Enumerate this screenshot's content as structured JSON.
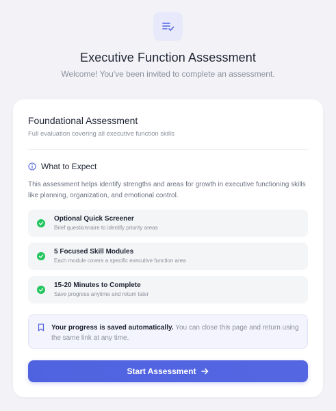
{
  "header": {
    "title": "Executive Function Assessment",
    "subtitle": "Welcome! You've been invited to complete an assessment.",
    "logo_icon": "list-check-icon"
  },
  "card": {
    "title": "Foundational Assessment",
    "description": "Full evaluation covering all executive function skills",
    "expect_heading": "What to Expect",
    "intro": "This assessment helps identify strengths and areas for growth in executive functioning skills like planning, organization, and emotional control.",
    "features": [
      {
        "title": "Optional Quick Screener",
        "description": "Brief questionnaire to identify priority areas"
      },
      {
        "title": "5 Focused Skill Modules",
        "description": "Each module covers a specific executive function area"
      },
      {
        "title": "15-20 Minutes to Complete",
        "description": "Save progress anytime and return later"
      }
    ],
    "notice": {
      "bold": "Your progress is saved automatically.",
      "text": " You can close this page and return using the same link at any time."
    },
    "start_button": "Start Assessment"
  },
  "colors": {
    "accent": "#4f63e0",
    "success": "#22c55e",
    "background": "#f3f3f7"
  }
}
